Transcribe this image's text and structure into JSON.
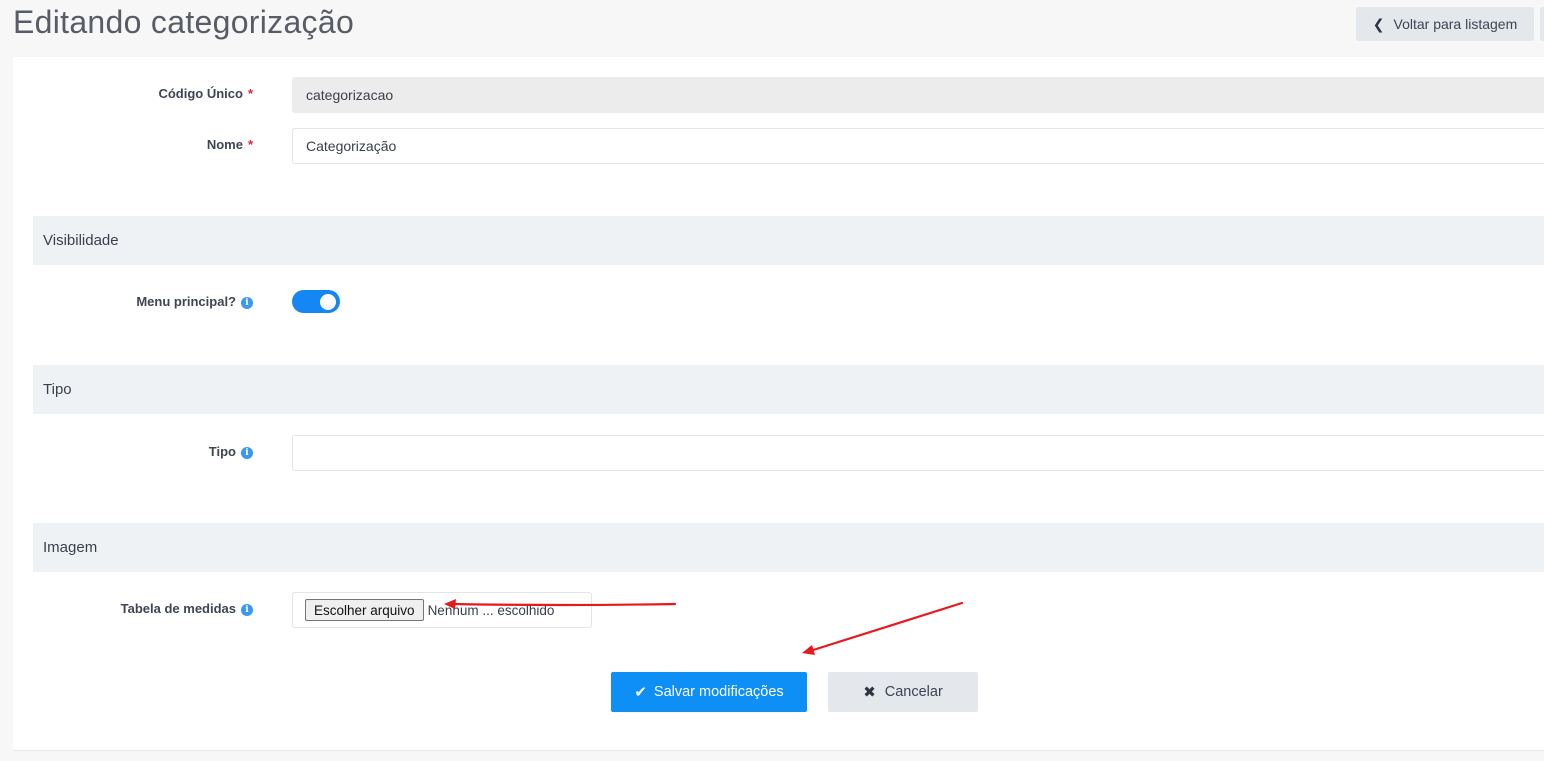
{
  "header": {
    "title": "Editando categorização",
    "back_label": "Voltar para listagem"
  },
  "form": {
    "codigo": {
      "label": "Código Único",
      "required_mark": "*",
      "value": "categorizacao"
    },
    "nome": {
      "label": "Nome",
      "required_mark": "*",
      "value": "Categorização"
    }
  },
  "sections": {
    "visibilidade": {
      "title": "Visibilidade",
      "menu_principal": {
        "label": "Menu principal?",
        "info_icon": "i",
        "enabled": true
      }
    },
    "tipo": {
      "title": "Tipo",
      "tipo_field": {
        "label": "Tipo",
        "info_icon": "i",
        "value": ""
      }
    },
    "imagem": {
      "title": "Imagem",
      "tabela": {
        "label": "Tabela de medidas",
        "info_icon": "i",
        "button_label": "Escolher arquivo",
        "file_status": "Nenhum ... escolhido"
      }
    }
  },
  "actions": {
    "save_label": "Salvar modificações",
    "cancel_label": "Cancelar"
  },
  "colors": {
    "primary": "#0d8ff5",
    "toggle_on": "#1487f5",
    "required": "#e0242d",
    "annotation_arrow": "#e8191e"
  }
}
